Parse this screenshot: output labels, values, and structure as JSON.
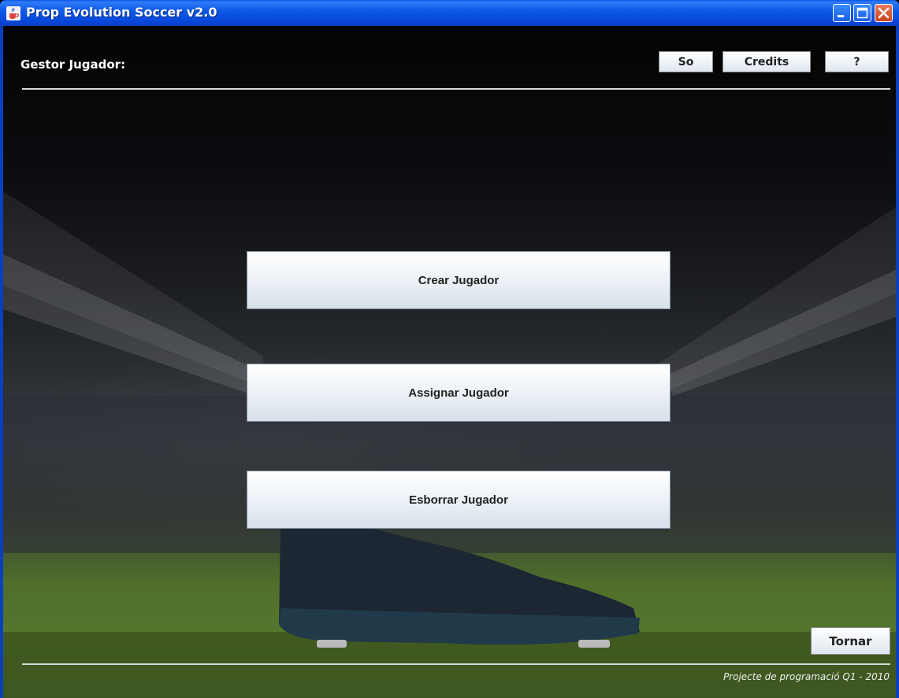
{
  "window": {
    "title": "Prop Evolution Soccer v2.0",
    "icon": "java-cup-icon",
    "controls": [
      "minimize-icon",
      "maximize-icon",
      "close-icon"
    ]
  },
  "header": {
    "label": "Gestor Jugador:",
    "buttons": {
      "so": "So",
      "credits": "Credits",
      "help": "?"
    }
  },
  "menu": {
    "create": "Crear Jugador",
    "assign": "Assignar Jugador",
    "delete": "Esborrar Jugador"
  },
  "back_button": "Tornar",
  "footer": "Projecte de programació Q1 - 2010",
  "colors": {
    "titlebar": "#0846d8",
    "close_button": "#c8441f",
    "button_face": "#eef3f8"
  }
}
